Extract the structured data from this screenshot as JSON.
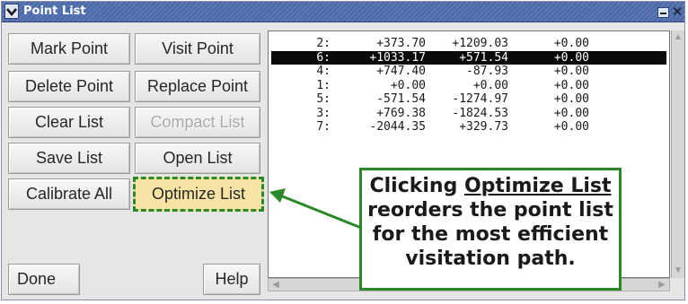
{
  "window": {
    "title": "Point List"
  },
  "buttons": {
    "mark_point": "Mark Point",
    "visit_point": "Visit Point",
    "delete_point": "Delete Point",
    "replace_point": "Replace Point",
    "clear_list": "Clear List",
    "compact_list": "Compact List",
    "save_list": "Save List",
    "open_list": "Open List",
    "calibrate_all": "Calibrate All",
    "optimize_list": "Optimize List",
    "done": "Done",
    "help": "Help"
  },
  "point_list": {
    "rows": [
      {
        "index": "2:",
        "x": "+373.70",
        "y": "+1209.03",
        "z": "+0.00",
        "selected": false
      },
      {
        "index": "6:",
        "x": "+1033.17",
        "y": "+571.54",
        "z": "+0.00",
        "selected": true
      },
      {
        "index": "4:",
        "x": "+747.40",
        "y": "-87.93",
        "z": "+0.00",
        "selected": false
      },
      {
        "index": "1:",
        "x": "+0.00",
        "y": "+0.00",
        "z": "+0.00",
        "selected": false
      },
      {
        "index": "5:",
        "x": "-571.54",
        "y": "-1274.97",
        "z": "+0.00",
        "selected": false
      },
      {
        "index": "3:",
        "x": "+769.38",
        "y": "-1824.53",
        "z": "+0.00",
        "selected": false
      },
      {
        "index": "7:",
        "x": "-2044.35",
        "y": "+329.73",
        "z": "+0.00",
        "selected": false
      }
    ]
  },
  "callout": {
    "prefix": "Clicking ",
    "link": "Optimize List",
    "line2": "reorders the point list",
    "line3": "for the most efficient",
    "line4": "visitation path."
  },
  "colors": {
    "title_bar": "#4a68a6",
    "callout_border": "#2a8a2a",
    "highlight_fill": "#f7e3a3",
    "selected_row": "#0a0a0a"
  },
  "icons": {
    "window_menu": "chevron-down-icon",
    "minimize": "minimize-icon",
    "close": "close-icon",
    "scroll_up": "scroll-up-arrow-icon",
    "scroll_down": "scroll-down-arrow-icon",
    "scroll_left": "scroll-left-arrow-icon",
    "scroll_right": "scroll-right-arrow-icon",
    "callout_pointer": "pointer-arrow-icon"
  }
}
